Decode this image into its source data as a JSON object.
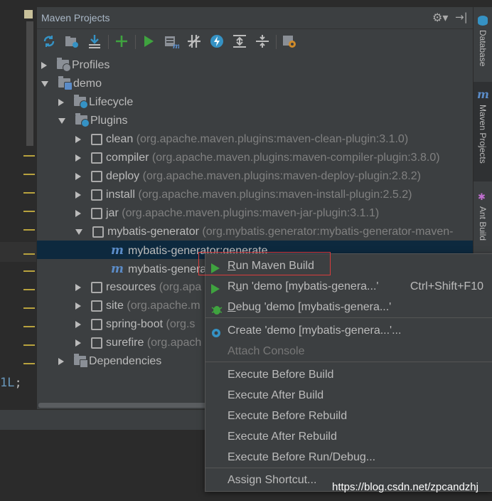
{
  "panel": {
    "title": "Maven Projects"
  },
  "editor": {
    "code_num": "1L",
    "code_rest": ";"
  },
  "sidebar": {
    "tabs": [
      {
        "label": "Database"
      },
      {
        "label": "Maven Projects"
      },
      {
        "label": "Ant Build"
      }
    ]
  },
  "tree": {
    "profiles": "Profiles",
    "demo": "demo",
    "lifecycle": "Lifecycle",
    "plugins": "Plugins",
    "plugin_items": [
      {
        "name": "clean",
        "detail": "(org.apache.maven.plugins:maven-clean-plugin:3.1.0)"
      },
      {
        "name": "compiler",
        "detail": "(org.apache.maven.plugins:maven-compiler-plugin:3.8.0)"
      },
      {
        "name": "deploy",
        "detail": "(org.apache.maven.plugins:maven-deploy-plugin:2.8.2)"
      },
      {
        "name": "install",
        "detail": "(org.apache.maven.plugins:maven-install-plugin:2.5.2)"
      },
      {
        "name": "jar",
        "detail": "(org.apache.maven.plugins:maven-jar-plugin:3.1.1)"
      },
      {
        "name": "mybatis-generator",
        "detail": "(org.mybatis.generator:mybatis-generator-maven-"
      }
    ],
    "goal_selected": "mybatis-generator:generate",
    "goal_second": "mybatis-genera",
    "more_plugins": [
      {
        "name": "resources",
        "detail": "(org.apa"
      },
      {
        "name": "site",
        "detail": "(org.apache.m"
      },
      {
        "name": "spring-boot",
        "detail": "(org.s"
      },
      {
        "name": "surefire",
        "detail": "(org.apach"
      }
    ],
    "dependencies": "Dependencies"
  },
  "menu": {
    "run_build_pre": "",
    "run_build_u": "R",
    "run_build_post": "un Maven Build",
    "run_demo_pre": "R",
    "run_demo_u": "u",
    "run_demo_post": "n 'demo [mybatis-genera...'",
    "run_demo_shortcut": "Ctrl+Shift+F10",
    "debug_u": "D",
    "debug_post": "ebug 'demo [mybatis-genera...'",
    "create": "Create 'demo [mybatis-genera...'...",
    "attach": "Attach Console",
    "exec_before_build": "Execute Before Build",
    "exec_after_build": "Execute After Build",
    "exec_before_rebuild": "Execute Before Rebuild",
    "exec_after_rebuild": "Execute After Rebuild",
    "exec_before_run": "Execute Before Run/Debug...",
    "assign_shortcut": "Assign Shortcut..."
  },
  "watermark": "https://blog.csdn.net/zpcandzhj",
  "colors": {
    "run_green": "#3fa33f",
    "highlight_red": "#d93c3c",
    "selection": "#0d293e"
  }
}
